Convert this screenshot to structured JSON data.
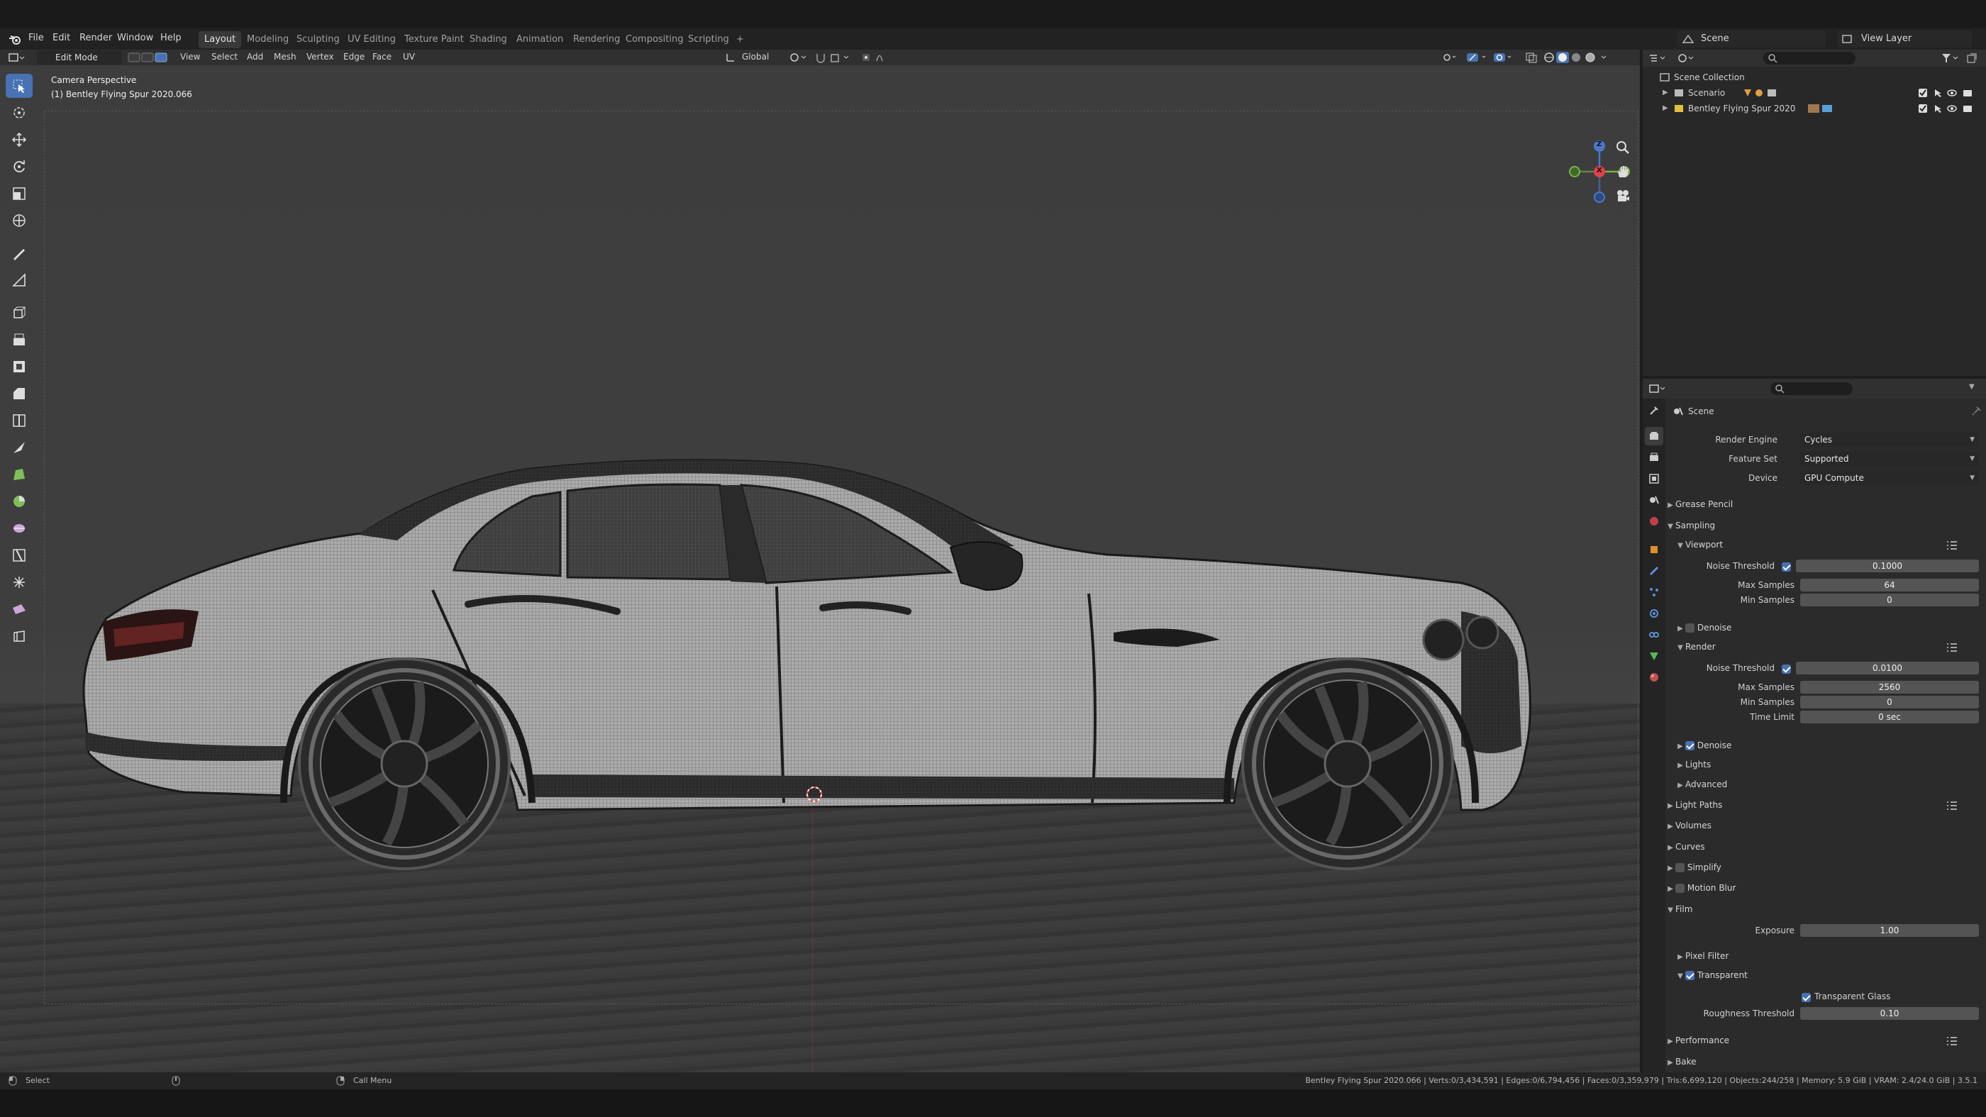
{
  "menu": {
    "file": "File",
    "edit": "Edit",
    "render": "Render",
    "window": "Window",
    "help": "Help"
  },
  "workspaces": [
    "Layout",
    "Modeling",
    "Sculpting",
    "UV Editing",
    "Texture Paint",
    "Shading",
    "Animation",
    "Rendering",
    "Compositing",
    "Scripting"
  ],
  "workspace_add": "+",
  "scene_name": "Scene",
  "view_layer": "View Layer",
  "viewport_header": {
    "mode": "Edit Mode",
    "view": "View",
    "select": "Select",
    "add": "Add",
    "mesh": "Mesh",
    "vertex": "Vertex",
    "edge": "Edge",
    "face": "Face",
    "uv": "UV",
    "orientation": "Global"
  },
  "viewport": {
    "title": "Camera Perspective",
    "object": "(1) Bentley Flying Spur 2020.066"
  },
  "gizmo": {
    "x": "X",
    "y": "Y",
    "z": "Z"
  },
  "outliner": {
    "root": "Scene Collection",
    "items": [
      {
        "label": "Scenario"
      },
      {
        "label": "Bentley Flying Spur 2020"
      }
    ]
  },
  "properties": {
    "context": "Scene",
    "render_engine_label": "Render Engine",
    "render_engine": "Cycles",
    "feature_set_label": "Feature Set",
    "feature_set": "Supported",
    "device_label": "Device",
    "device": "GPU Compute",
    "grease_pencil": "Grease Pencil",
    "sampling": "Sampling",
    "viewport": "Viewport",
    "noise_threshold_label": "Noise Threshold",
    "vp_noise_threshold": "0.1000",
    "max_samples_label": "Max Samples",
    "vp_max_samples": "64",
    "min_samples_label": "Min Samples",
    "vp_min_samples": "0",
    "denoise": "Denoise",
    "render": "Render",
    "r_noise_threshold": "0.0100",
    "r_max_samples": "2560",
    "r_min_samples": "0",
    "time_limit_label": "Time Limit",
    "r_time_limit": "0 sec",
    "lights": "Lights",
    "advanced": "Advanced",
    "light_paths": "Light Paths",
    "volumes": "Volumes",
    "curves": "Curves",
    "simplify": "Simplify",
    "motion_blur": "Motion Blur",
    "film": "Film",
    "exposure_label": "Exposure",
    "exposure": "1.00",
    "pixel_filter": "Pixel Filter",
    "transparent": "Transparent",
    "transparent_glass": "Transparent Glass",
    "roughness_threshold_label": "Roughness Threshold",
    "roughness_threshold": "0.10",
    "performance": "Performance",
    "bake": "Bake"
  },
  "status": {
    "select": "Select",
    "call_menu": "Call Menu",
    "stats": "Bentley Flying Spur 2020.066 | Verts:0/3,434,591 | Edges:0/6,794,456 | Faces:0/3,359,979 | Tris:6,699,120 | Objects:244/258 | Memory: 5.9 GiB | VRAM: 2.4/24.0 GiB | 3.5.1"
  }
}
